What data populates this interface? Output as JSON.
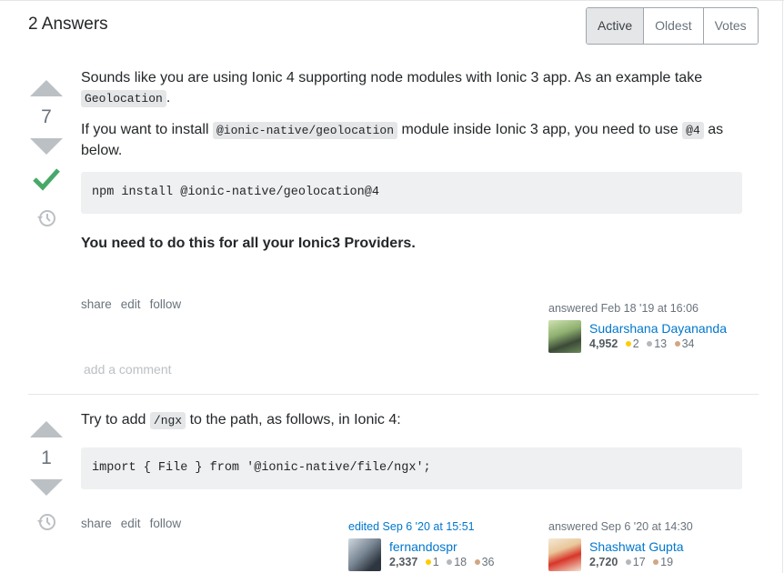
{
  "header": {
    "answers_count": "2 Answers"
  },
  "sort_tabs": [
    "Active",
    "Oldest",
    "Votes"
  ],
  "colors": {
    "link": "#0077cc",
    "accepted": "#48a868",
    "gold": "#ffcc01",
    "silver": "#b4b8bc",
    "bronze": "#d1a684"
  },
  "answers": [
    {
      "votes": "7",
      "accepted": true,
      "p1_a": "Sounds like you are using Ionic 4 supporting node modules with Ionic 3 app. As an example take",
      "p1_code": "Geolocation",
      "p1_b": ".",
      "p2_a": "If you want to install",
      "p2_code1": "@ionic-native/geolocation",
      "p2_b": "module inside Ionic 3 app, you need to use",
      "p2_code2": "@4",
      "p2_c": "as below.",
      "code": "npm install @ionic-native/geolocation@4",
      "bold_text": "You need to do this for all your Ionic3 Providers.",
      "menu": [
        "share",
        "edit",
        "follow"
      ],
      "answered": {
        "label": "answered Feb 18 '19 at 16:06",
        "name": "Sudarshana Dayananda",
        "rep": "4,952",
        "gold": "2",
        "silver": "13",
        "bronze": "34"
      },
      "add_comment": "add a comment"
    },
    {
      "votes": "1",
      "accepted": false,
      "p1_a": "Try to add",
      "p1_code": "/ngx",
      "p1_b": "to the path, as follows, in Ionic 4:",
      "code": "import { File } from '@ionic-native/file/ngx';",
      "menu": [
        "share",
        "edit",
        "follow"
      ],
      "edited": {
        "label": "edited Sep 6 '20 at 15:51",
        "name": "fernandospr",
        "rep": "2,337",
        "gold": "1",
        "silver": "18",
        "bronze": "36"
      },
      "answered": {
        "label": "answered Sep 6 '20 at 14:30",
        "name": "Shashwat Gupta",
        "rep": "2,720",
        "silver": "17",
        "bronze": "19"
      }
    }
  ]
}
